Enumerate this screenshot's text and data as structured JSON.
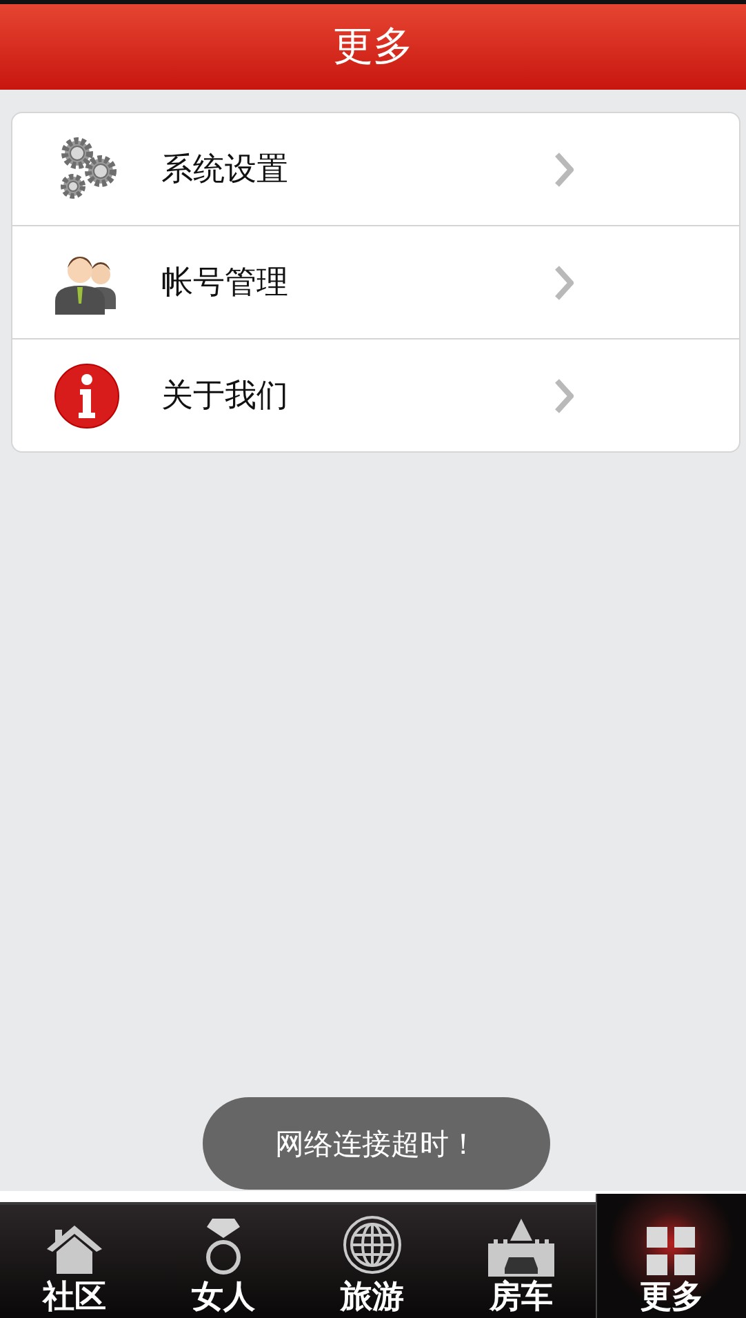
{
  "header": {
    "title": "更多"
  },
  "menu": [
    {
      "kind": "gears",
      "label": "系统设置"
    },
    {
      "kind": "people",
      "label": "帐号管理"
    },
    {
      "kind": "info",
      "label": "关于我们"
    }
  ],
  "toast": "网络连接超时！",
  "tabs": [
    {
      "kind": "home",
      "label": "社区",
      "selected": false
    },
    {
      "kind": "ring",
      "label": "女人",
      "selected": false
    },
    {
      "kind": "globe",
      "label": "旅游",
      "selected": false
    },
    {
      "kind": "castle",
      "label": "房车",
      "selected": false
    },
    {
      "kind": "grid",
      "label": "更多",
      "selected": true
    }
  ]
}
